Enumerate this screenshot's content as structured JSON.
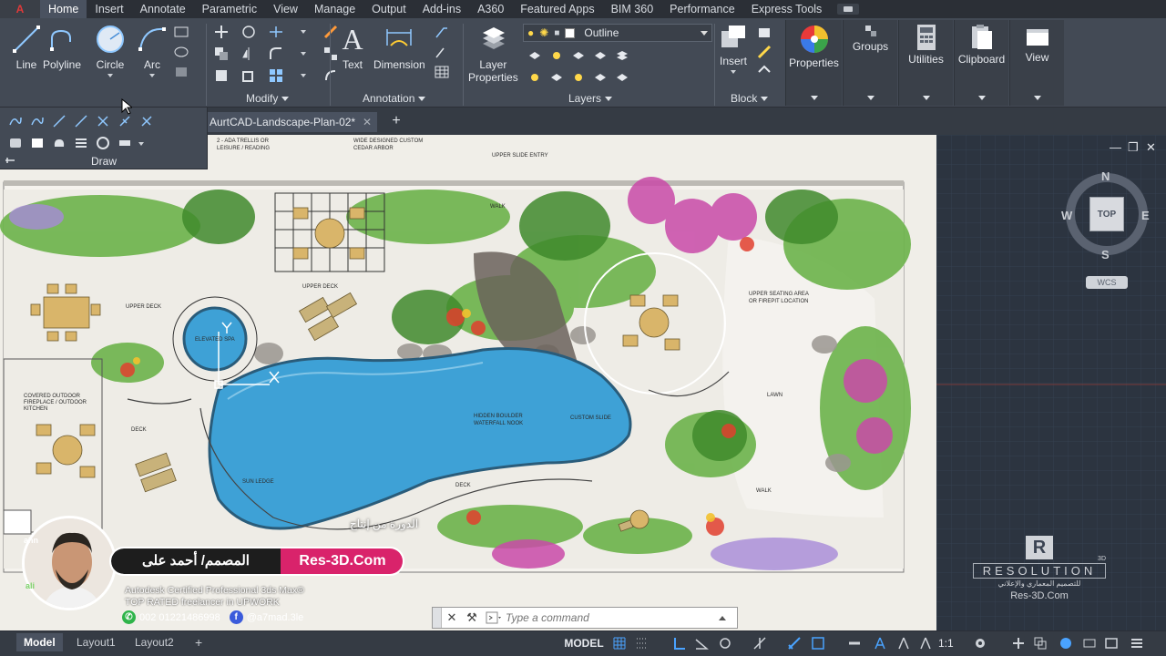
{
  "ribbon_tabs": [
    "Home",
    "Insert",
    "Annotate",
    "Parametric",
    "View",
    "Manage",
    "Output",
    "Add-ins",
    "A360",
    "Featured Apps",
    "BIM 360",
    "Performance",
    "Express Tools"
  ],
  "active_tab": "Home",
  "draw_tools": {
    "line": "Line",
    "polyline": "Polyline",
    "circle": "Circle",
    "arc": "Arc"
  },
  "panels": {
    "modify": "Modify",
    "annotation": "Annotation",
    "layers": "Layers",
    "block": "Block",
    "draw": "Draw"
  },
  "annotation_tools": {
    "text": "Text",
    "dimension": "Dimension"
  },
  "layer_tools": {
    "layer_properties_line1": "Layer",
    "layer_properties_line2": "Properties",
    "current_layer": "Outline"
  },
  "block_tools": {
    "insert": "Insert"
  },
  "right_buttons": {
    "properties": "Properties",
    "groups": "Groups",
    "utilities": "Utilities",
    "clipboard": "Clipboard",
    "view": "View"
  },
  "file_tab": {
    "name": "AurtCAD-Landscape-Plan-02*",
    "close": "✕",
    "new": "+"
  },
  "window_controls": {
    "minimize": "—",
    "restore": "❐",
    "close": "✕"
  },
  "viewcube": {
    "n": "N",
    "s": "S",
    "e": "E",
    "w": "W",
    "face": "TOP",
    "wcs": "WCS"
  },
  "command_line": {
    "placeholder": "Type a command"
  },
  "layout_tabs": [
    "Model",
    "Layout1",
    "Layout2"
  ],
  "layout_add": "+",
  "status": {
    "model": "MODEL",
    "scale": "1:1"
  },
  "promo": {
    "name_ar": "المصمم/ أحمد على",
    "site": "Res-3D.Com",
    "line1": "Autodesk Certified Professional 3ds Max®",
    "line2": "TOP RATED freelancer in UPWORK",
    "phone": "002 01221486998",
    "social": "@a7mad.3le",
    "overlay_ar": "الدورة من إنتاج",
    "avatar_tag_top": "ahn",
    "avatar_tag_bottom": "ali"
  },
  "watermark": {
    "letter": "R",
    "word": "RESOLUTION",
    "sup": "3D",
    "arabic": "للتصميم المعماري والإعلاني",
    "site": "Res-3D.Com"
  },
  "plan_labels": {
    "upper_deck_1": "UPPER DECK",
    "upper_deck_2": "UPPER DECK",
    "elevated_spa": "ELEVATED SPA",
    "upper_seating": "UPPER SEATING AREA",
    "upper_seating_2": "OR FIREPIT LOCATION",
    "lawn": "LAWN",
    "hidden_boulder": "HIDDEN BOULDER",
    "waterfall": "WATERFALL NOOK",
    "custom_slide": "CUSTOM SLIDE",
    "deck_1": "DECK",
    "deck_2": "DECK",
    "sun_ledge": "SUN LEDGE",
    "walk_1": "WALK",
    "walk_2": "WALK",
    "upper_slide": "UPPER SLIDE ENTRY",
    "cedar_arbor": "WIDE DESIGNED CUSTOM",
    "cedar_arbor_2": "CEDAR ARBOR",
    "leisure": "2 - ADA TRELLIS OR",
    "leisure_2": "LEISURE / READING",
    "covered_outdoor": "COVERED OUTDOOR",
    "covered_outdoor_2": "FIREPLACE / OUTDOOR",
    "covered_outdoor_3": "KITCHEN"
  }
}
